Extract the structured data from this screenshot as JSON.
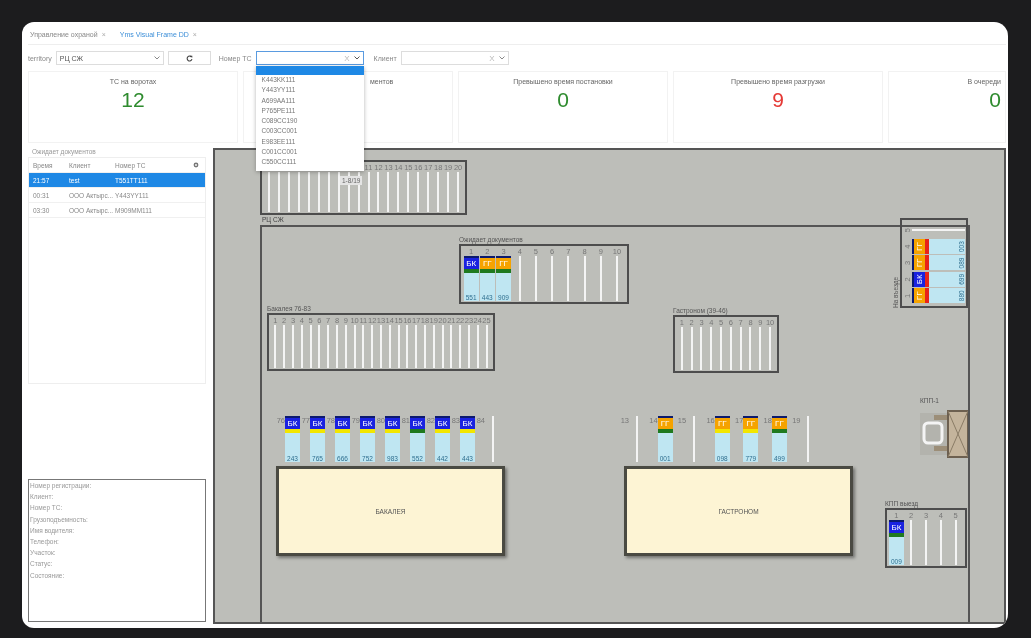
{
  "tabs": [
    {
      "label": "Управление охраной",
      "close": "×",
      "selected": false
    },
    {
      "label": "Yms Visual Frame DD",
      "close": "×",
      "selected": true
    }
  ],
  "filters": {
    "territory": {
      "label": "territory",
      "value": "РЦ СЖ"
    },
    "vehicle": {
      "label": "Номер ТС",
      "clear": "X",
      "open": true
    },
    "client": {
      "label": "Клиент",
      "clear": "X",
      "open": false
    }
  },
  "plate_dropdown": {
    "blank_option": {
      "selected": true
    },
    "options": [
      "K443KK111",
      "Y443YY111",
      "A699AA111",
      "P765PE111",
      "C089CC190",
      "C003CC001",
      "E983EE111",
      "C001CC001",
      "C550CC111"
    ]
  },
  "cards": [
    {
      "kind": "full",
      "title": "ТС на воротах",
      "value": "12",
      "color": "#2e8b2e"
    },
    {
      "kind": "covered",
      "title": "ментов"
    },
    {
      "kind": "full",
      "title": "Превышено время постановки",
      "value": "0",
      "color": "#2e8b2e"
    },
    {
      "kind": "full",
      "title": "Превышено время разгрузки",
      "value": "9",
      "color": "#e53935"
    },
    {
      "kind": "full",
      "title": "В очереди",
      "value": "0",
      "color": "#2e8b2e"
    }
  ],
  "waiting_panel": {
    "title": "Ожидает документов",
    "columns": [
      "Время",
      "Клиент",
      "Номер ТС"
    ],
    "rows": [
      {
        "cells": [
          "21:57",
          "test",
          "T551TT111"
        ],
        "selected": true
      },
      {
        "cells": [
          "00:31",
          "ООО Актырс...",
          "Y443YY111"
        ],
        "selected": false
      },
      {
        "cells": [
          "03:30",
          "ООО Актырс...",
          "M909MM111"
        ],
        "selected": false
      }
    ]
  },
  "details": [
    "Номер регистрации:",
    "Клиент:",
    "Номер ТС:",
    "Грузоподъемность:",
    "Имя водителя:",
    "Телефон:",
    "Участок:",
    "Статус:",
    "Состояние:"
  ],
  "map": {
    "area_label": "РЦ СЖ",
    "zones": [
      {
        "kind": "rack_partial",
        "tag": "1-8/19",
        "slots": [
          {
            "number": "11"
          },
          {
            "number": "12"
          },
          {
            "number": "13"
          },
          {
            "number": "14"
          },
          {
            "number": "15"
          },
          {
            "number": "16"
          },
          {
            "number": "17"
          },
          {
            "number": "18"
          },
          {
            "number": "19"
          },
          {
            "number": "20"
          }
        ]
      },
      {
        "kind": "rack",
        "title": "Ожидает документов",
        "slots": [
          {
            "number": "1",
            "truck": {
              "badge": {
                "text": "БК",
                "color": "#1a22e0"
              },
              "stripe": {
                "color": "#1f7a1f"
              },
              "plate": "551"
            }
          },
          {
            "number": "2",
            "truck": {
              "badge": {
                "text": "ГГ",
                "color": "#f5a300"
              },
              "stripe": {
                "color": "#1f7a1f"
              },
              "plate": "443"
            }
          },
          {
            "number": "3",
            "truck": {
              "badge": {
                "text": "ГГ",
                "color": "#f5a300"
              },
              "stripe": {
                "color": "#1f7a1f"
              },
              "plate": "909"
            }
          },
          {
            "number": "4"
          },
          {
            "number": "5"
          },
          {
            "number": "6"
          },
          {
            "number": "7"
          },
          {
            "number": "8"
          },
          {
            "number": "9"
          },
          {
            "number": "10"
          }
        ]
      },
      {
        "kind": "rack_rotated",
        "title": "На въезде",
        "slots": [
          {
            "number": "1",
            "truck": {
              "badge": {
                "text": "ГГ",
                "color": "#f5a300"
              },
              "stripe": {
                "color": "#e8231a"
              },
              "plate": "880"
            }
          },
          {
            "number": "2",
            "truck": {
              "badge": {
                "text": "БК",
                "color": "#1a22e0"
              },
              "stripe": {
                "color": "#e8231a"
              },
              "plate": "699"
            }
          },
          {
            "number": "3",
            "truck": {
              "badge": {
                "text": "ГГ",
                "color": "#f5a300"
              },
              "stripe": {
                "color": "#e8231a"
              },
              "plate": "089"
            }
          },
          {
            "number": "4",
            "truck": {
              "badge": {
                "text": "ГГ",
                "color": "#f5a300"
              },
              "stripe": {
                "color": "#e8231a"
              },
              "plate": "003"
            }
          },
          {
            "number": "5"
          }
        ]
      },
      {
        "kind": "rack",
        "title": "Бакалея 76-83",
        "slots": [
          {
            "number": "1"
          },
          {
            "number": "2"
          },
          {
            "number": "3"
          },
          {
            "number": "4"
          },
          {
            "number": "5"
          },
          {
            "number": "6"
          },
          {
            "number": "7"
          },
          {
            "number": "8"
          },
          {
            "number": "9"
          },
          {
            "number": "10"
          },
          {
            "number": "11"
          },
          {
            "number": "12"
          },
          {
            "number": "13"
          },
          {
            "number": "14"
          },
          {
            "number": "15"
          },
          {
            "number": "16"
          },
          {
            "number": "17"
          },
          {
            "number": "18"
          },
          {
            "number": "19"
          },
          {
            "number": "20"
          },
          {
            "number": "21"
          },
          {
            "number": "22"
          },
          {
            "number": "23"
          },
          {
            "number": "24"
          },
          {
            "number": "25"
          }
        ]
      },
      {
        "kind": "rack",
        "title": "Гастроном (39-46)",
        "slots": [
          {
            "number": "1"
          },
          {
            "number": "2"
          },
          {
            "number": "3"
          },
          {
            "number": "4"
          },
          {
            "number": "5"
          },
          {
            "number": "6"
          },
          {
            "number": "7"
          },
          {
            "number": "8"
          },
          {
            "number": "9"
          },
          {
            "number": "10"
          }
        ]
      },
      {
        "kind": "gates",
        "slots": [
          {
            "number": "76",
            "truck": {
              "badge": {
                "text": "БК",
                "color": "#1a22e0"
              },
              "stripe": {
                "color": "#f2e600"
              },
              "plate": "243"
            }
          },
          {
            "number": "77",
            "truck": {
              "badge": {
                "text": "БК",
                "color": "#1a22e0"
              },
              "stripe": {
                "color": "#f2e600"
              },
              "plate": "765"
            }
          },
          {
            "number": "78",
            "truck": {
              "badge": {
                "text": "БК",
                "color": "#1a22e0"
              },
              "stripe": {
                "color": "#f2e600"
              },
              "plate": "666"
            }
          },
          {
            "number": "79",
            "truck": {
              "badge": {
                "text": "БК",
                "color": "#1a22e0"
              },
              "stripe": {
                "color": "#f2e600"
              },
              "plate": "752"
            }
          },
          {
            "number": "80",
            "truck": {
              "badge": {
                "text": "БК",
                "color": "#1a22e0"
              },
              "stripe": {
                "color": "#f2e600"
              },
              "plate": "983"
            }
          },
          {
            "number": "81",
            "truck": {
              "badge": {
                "text": "БК",
                "color": "#1a22e0"
              },
              "stripe": {
                "color": "#1f7a1f"
              },
              "plate": "552"
            }
          },
          {
            "number": "82",
            "truck": {
              "badge": {
                "text": "БК",
                "color": "#1a22e0"
              },
              "stripe": {
                "color": "#f2e600"
              },
              "plate": "442"
            }
          },
          {
            "number": "83",
            "truck": {
              "badge": {
                "text": "БК",
                "color": "#1a22e0"
              },
              "stripe": {
                "color": "#f2e600"
              },
              "plate": "443"
            }
          },
          {
            "number": "84"
          }
        ]
      },
      {
        "kind": "building",
        "title": "БАКАЛЕЯ"
      },
      {
        "kind": "gates",
        "slots": [
          {
            "number": "13"
          },
          {
            "number": "14",
            "truck": {
              "badge": {
                "text": "ГГ",
                "color": "#f5a300"
              },
              "stripe": {
                "color": "#1f7a1f"
              },
              "plate": "001"
            }
          },
          {
            "number": "15"
          },
          {
            "number": "16",
            "truck": {
              "badge": {
                "text": "ГГ",
                "color": "#f5a300"
              },
              "stripe": {
                "color": "#f2e600"
              },
              "plate": "098"
            }
          },
          {
            "number": "17",
            "truck": {
              "badge": {
                "text": "ГГ",
                "color": "#f5a300"
              },
              "stripe": {
                "color": "#f2e600"
              },
              "plate": "779"
            }
          },
          {
            "number": "18",
            "truck": {
              "badge": {
                "text": "ГГ",
                "color": "#f5a300"
              },
              "stripe": {
                "color": "#1f7a1f"
              },
              "plate": "499"
            }
          },
          {
            "number": "19"
          }
        ]
      },
      {
        "kind": "building",
        "title": "ГАСТРОНОМ"
      },
      {
        "kind": "checkpoint",
        "title": "КПП-1"
      },
      {
        "kind": "rack",
        "title": "КПП выезд",
        "slots": [
          {
            "number": "1",
            "truck": {
              "badge": {
                "text": "БК",
                "color": "#1a22e0"
              },
              "stripe": {
                "color": "#1f7a1f"
              },
              "plate": "009"
            }
          },
          {
            "number": "2"
          },
          {
            "number": "3"
          },
          {
            "number": "4"
          },
          {
            "number": "5"
          }
        ]
      }
    ]
  }
}
